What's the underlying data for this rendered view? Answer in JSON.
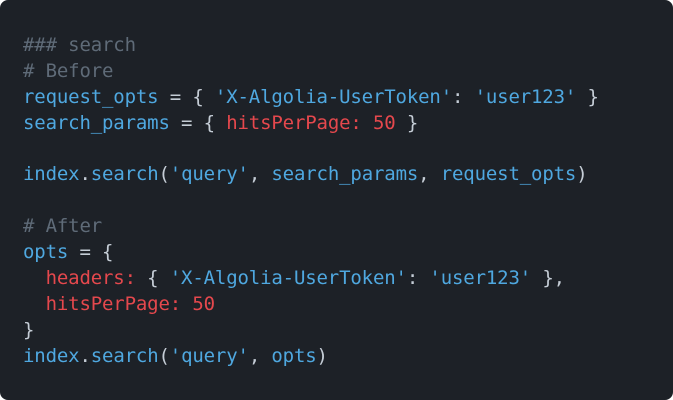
{
  "colors": {
    "background": "#1d2127",
    "comment": "#5f6b78",
    "identifier": "#4fa8e0",
    "punctuation": "#c5cdd6",
    "key_number": "#e5484d"
  },
  "code_lines": [
    [
      {
        "t": "### search",
        "k": "comment"
      }
    ],
    [
      {
        "t": "# Before",
        "k": "comment"
      }
    ],
    [
      {
        "t": "request_opts",
        "k": "ident"
      },
      {
        "t": " = { ",
        "k": "punct"
      },
      {
        "t": "'X-Algolia-UserToken'",
        "k": "string"
      },
      {
        "t": ": ",
        "k": "punct"
      },
      {
        "t": "'user123'",
        "k": "string"
      },
      {
        "t": " }",
        "k": "punct"
      }
    ],
    [
      {
        "t": "search_params",
        "k": "ident"
      },
      {
        "t": " = { ",
        "k": "punct"
      },
      {
        "t": "hitsPerPage:",
        "k": "key"
      },
      {
        "t": " ",
        "k": "punct"
      },
      {
        "t": "50",
        "k": "number"
      },
      {
        "t": " }",
        "k": "punct"
      }
    ],
    [],
    [
      {
        "t": "index",
        "k": "ident"
      },
      {
        "t": ".",
        "k": "punct"
      },
      {
        "t": "search",
        "k": "ident"
      },
      {
        "t": "(",
        "k": "punct"
      },
      {
        "t": "'query'",
        "k": "string"
      },
      {
        "t": ", ",
        "k": "punct"
      },
      {
        "t": "search_params",
        "k": "ident"
      },
      {
        "t": ", ",
        "k": "punct"
      },
      {
        "t": "request_opts",
        "k": "ident"
      },
      {
        "t": ")",
        "k": "punct"
      }
    ],
    [],
    [
      {
        "t": "# After",
        "k": "comment"
      }
    ],
    [
      {
        "t": "opts",
        "k": "ident"
      },
      {
        "t": " = {",
        "k": "punct"
      }
    ],
    [
      {
        "t": "  ",
        "k": "punct"
      },
      {
        "t": "headers:",
        "k": "key"
      },
      {
        "t": " { ",
        "k": "punct"
      },
      {
        "t": "'X-Algolia-UserToken'",
        "k": "string"
      },
      {
        "t": ": ",
        "k": "punct"
      },
      {
        "t": "'user123'",
        "k": "string"
      },
      {
        "t": " },",
        "k": "punct"
      }
    ],
    [
      {
        "t": "  ",
        "k": "punct"
      },
      {
        "t": "hitsPerPage:",
        "k": "key"
      },
      {
        "t": " ",
        "k": "punct"
      },
      {
        "t": "50",
        "k": "number"
      }
    ],
    [
      {
        "t": "}",
        "k": "punct"
      }
    ],
    [
      {
        "t": "index",
        "k": "ident"
      },
      {
        "t": ".",
        "k": "punct"
      },
      {
        "t": "search",
        "k": "ident"
      },
      {
        "t": "(",
        "k": "punct"
      },
      {
        "t": "'query'",
        "k": "string"
      },
      {
        "t": ", ",
        "k": "punct"
      },
      {
        "t": "opts",
        "k": "ident"
      },
      {
        "t": ")",
        "k": "punct"
      }
    ]
  ]
}
